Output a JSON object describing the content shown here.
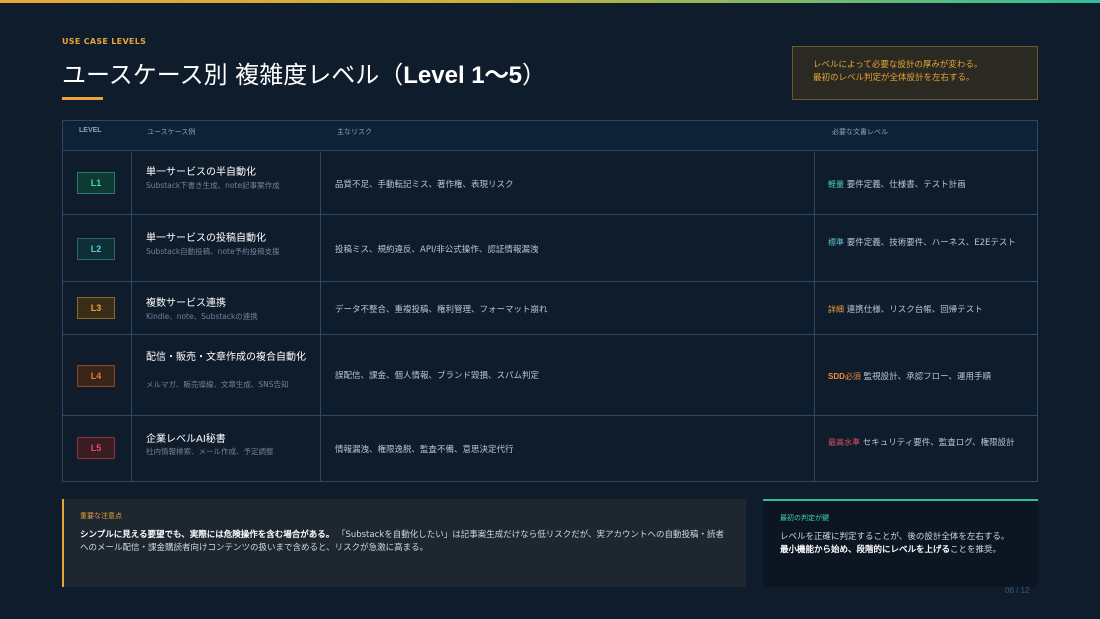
{
  "header": {
    "eyebrow": "USE CASE LEVELS",
    "title_jp": "ユースケース別 複雑度レベル（",
    "title_en": "Level 1〜5",
    "title_end": "）",
    "note_line1": "レベルによって必要な設計の厚みが変わる。",
    "note_line2": "最初のレベル判定が全体設計を左右する。"
  },
  "table": {
    "headers": {
      "level": "LEVEL",
      "use_case": "ユースケース例",
      "risk": "主なリスク",
      "docs": "必要な文書レベル"
    },
    "rows": [
      {
        "level": "L1",
        "title": "単一サービスの半自動化",
        "sub": "Substack下書き生成、note記事案作成",
        "risk": "品質不足、手動転記ミス、著作権、表現リスク",
        "doc_tag": "軽量",
        "doc_text": "要件定義、仕様書、テスト計画"
      },
      {
        "level": "L2",
        "title": "単一サービスの投稿自動化",
        "sub": "Substack自動投稿、note予約投稿支援",
        "risk": "投稿ミス、規約違反、API/非公式操作、認証情報漏洩",
        "doc_tag": "標準",
        "doc_text": "要件定義、技術要件、ハーネス、E2Eテスト"
      },
      {
        "level": "L3",
        "title": "複数サービス連携",
        "sub": "Kindle、note、Substackの連携",
        "risk": "データ不整合、重複投稿、権利管理、フォーマット崩れ",
        "doc_tag": "詳細",
        "doc_text": "連携仕様、リスク台帳、回帰テスト"
      },
      {
        "level": "L4",
        "title": "配信・販売・文章作成の複合自動化",
        "sub": "メルマガ、販売導線、文章生成、SNS告知",
        "risk": "誤配信、課金、個人情報、ブランド毀損、スパム判定",
        "doc_tag_sdd": "SDD",
        "doc_tag": "必須",
        "doc_text": "監視設計、承認フロー、運用手順"
      },
      {
        "level": "L5",
        "title": "企業レベルAI秘書",
        "sub": "社内情報検索、メール作成、予定調整",
        "risk": "情報漏洩、権限逸脱、監査不備、意思決定代行",
        "doc_tag": "最高水準",
        "doc_text": "セキュリティ要件、監査ログ、権限設計"
      }
    ]
  },
  "warning": {
    "heading": "重要な注意点",
    "bold": "シンプルに見える要望でも、実際には危険操作を含む場合がある。",
    "text": "「Substackを自動化したい」は記事案生成だけなら低リスクだが、実アカウントへの自動投稿・読者へのメール配信・課金購読者向けコンテンツの扱いまで含めると、リスクが急激に高まる。"
  },
  "key": {
    "heading": "最初の判定が鍵",
    "line1": "レベルを正確に判定することが、後の設計全体を左右する。",
    "bold": "最小機能から始め、段階的にレベルを上げる",
    "tail": "ことを推奨。"
  },
  "footer": {
    "page": "06 / 12"
  },
  "colors": {
    "accent": "#e8a33a",
    "teal": "#2fbf9a",
    "background": "#0f1c2c"
  }
}
